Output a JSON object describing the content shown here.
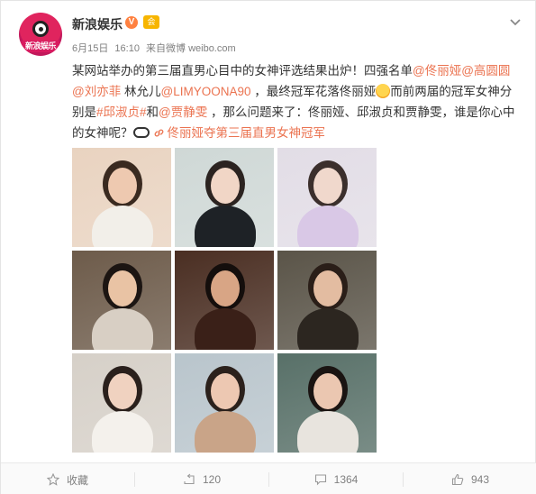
{
  "account": {
    "name": "新浪娱乐",
    "verified_mark": "V",
    "member_mark": "会",
    "avatar_text": "新浪娱乐"
  },
  "meta": {
    "date": "6月15日",
    "time": "16:10",
    "source_prefix": "来自",
    "source": "微博 weibo.com"
  },
  "post": {
    "segments": [
      {
        "type": "text",
        "value": "某网站举办的第三届直男心目中的女神评选结果出炉！四强名单"
      },
      {
        "type": "link",
        "value": "@佟丽娅"
      },
      {
        "type": "link",
        "value": "@高圆圆"
      },
      {
        "type": "link",
        "value": "@刘亦菲"
      },
      {
        "type": "text",
        "value": " 林允儿"
      },
      {
        "type": "link",
        "value": "@LIMYOONA90"
      },
      {
        "type": "text",
        "value": " ，最终冠军花落佟丽娅"
      },
      {
        "type": "emoji",
        "value": "cry"
      },
      {
        "type": "text",
        "value": "而前两届的冠军女神分别是"
      },
      {
        "type": "link",
        "value": "#邱淑贞#"
      },
      {
        "type": "text",
        "value": "和"
      },
      {
        "type": "link",
        "value": "@贾静雯"
      },
      {
        "type": "text",
        "value": " ，那么问题来了：佟丽娅、邱淑贞和贾静雯，谁是你心中的女神呢？"
      },
      {
        "type": "emoji",
        "value": "glasses"
      },
      {
        "type": "topic",
        "value": "佟丽娅夺第三届直男女神冠军"
      }
    ]
  },
  "photos": [
    {
      "bg": "#e9d3c0",
      "skin": "#eec9b0",
      "hair": "#3a2a20",
      "cloth": "#f2efe9"
    },
    {
      "bg": "#cfd8d6",
      "skin": "#f1d6c6",
      "hair": "#2b2320",
      "cloth": "#1e2226"
    },
    {
      "bg": "#e2dde6",
      "skin": "#f0d8cc",
      "hair": "#3b2f2c",
      "cloth": "#d9c8e6"
    },
    {
      "bg": "#6d5b4a",
      "skin": "#e9c3a4",
      "hair": "#1c1512",
      "cloth": "#d8cfc4"
    },
    {
      "bg": "#4a2e22",
      "skin": "#d8a585",
      "hair": "#140e0c",
      "cloth": "#3a2018"
    },
    {
      "bg": "#5a5448",
      "skin": "#e3bca1",
      "hair": "#2a1e18",
      "cloth": "#2c2620"
    },
    {
      "bg": "#d6d0c8",
      "skin": "#f0d2c0",
      "hair": "#2a201c",
      "cloth": "#f4f1ec"
    },
    {
      "bg": "#b9c5cc",
      "skin": "#edc8b2",
      "hair": "#2b211c",
      "cloth": "#c9a488"
    },
    {
      "bg": "#587068",
      "skin": "#ebc7b1",
      "hair": "#1a1412",
      "cloth": "#e8e4de"
    }
  ],
  "actions": {
    "favorite_label": "收藏",
    "repost_count": "120",
    "comment_count": "1364",
    "like_count": "943"
  },
  "icons": {
    "chevron": "chevron-down-icon",
    "favorite": "star-icon",
    "repost": "repost-icon",
    "comment": "comment-icon",
    "like": "thumbs-up-icon"
  },
  "colors": {
    "link": "#eb7350",
    "text": "#333333",
    "meta": "#808080"
  }
}
